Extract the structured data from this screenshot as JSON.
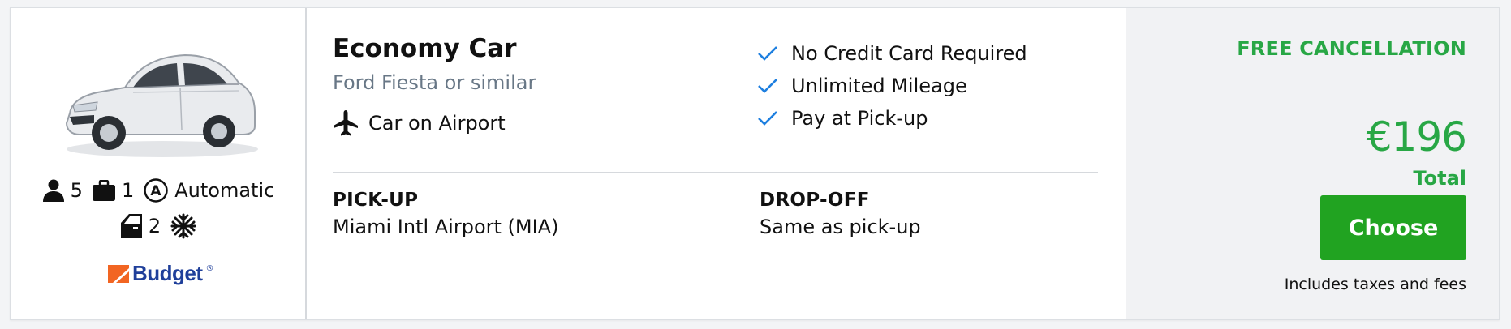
{
  "vehicle": {
    "category": "Economy Car",
    "model": "Ford Fiesta or similar",
    "location_type": "Car on Airport",
    "passengers": "5",
    "bags": "1",
    "transmission": "Automatic",
    "doors": "2",
    "image_icon": "car-image",
    "air_conditioning_icon": "snowflake-icon"
  },
  "supplier": {
    "name": "Budget",
    "trademark": "®"
  },
  "features": [
    "No Credit Card Required",
    "Unlimited Mileage",
    "Pay at Pick-up"
  ],
  "pickup": {
    "label": "PICK-UP",
    "value": "Miami Intl Airport (MIA)"
  },
  "dropoff": {
    "label": "DROP-OFF",
    "value": "Same as pick-up"
  },
  "pricing": {
    "free_cancellation": "FREE CANCELLATION",
    "price": "€196",
    "total_label": "Total",
    "button_label": "Choose",
    "taxes_note": "Includes taxes and fees"
  },
  "colors": {
    "accent_green": "#28a745",
    "button_green": "#21a321",
    "check_blue": "#1e7fe0",
    "subtitle_gray": "#687786",
    "brand_blue": "#1f3f9a",
    "brand_orange": "#f26522"
  }
}
